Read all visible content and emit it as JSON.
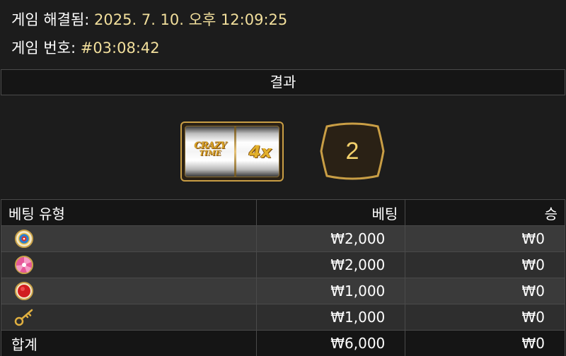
{
  "info": {
    "resolved_label": "게임 해결됨:",
    "resolved_value": "2025. 7. 10. 오후 12:09:25",
    "game_no_label": "게임 번호:",
    "game_no_value": "#03:08:42"
  },
  "result": {
    "header": "결과",
    "slot": {
      "logo_line1": "CRAZY",
      "logo_line2": "TIME",
      "multiplier": "4x"
    },
    "value": "2"
  },
  "table": {
    "headers": {
      "type": "베팅 유형",
      "bet": "베팅",
      "win": "승"
    },
    "rows": [
      {
        "icon": "coin-flip-icon",
        "bet": "₩2,000",
        "win": "₩0"
      },
      {
        "icon": "pachinko-icon",
        "bet": "₩2,000",
        "win": "₩0"
      },
      {
        "icon": "cash-hunt-icon",
        "bet": "₩1,000",
        "win": "₩0"
      },
      {
        "icon": "crazy-time-key-icon",
        "bet": "₩1,000",
        "win": "₩0"
      }
    ],
    "total": {
      "label": "합계",
      "bet": "₩6,000",
      "win": "₩0"
    }
  },
  "colors": {
    "accent_gold": "#f2df9c",
    "badge_gold": "#c99e45",
    "background": "#1c1c1c"
  }
}
